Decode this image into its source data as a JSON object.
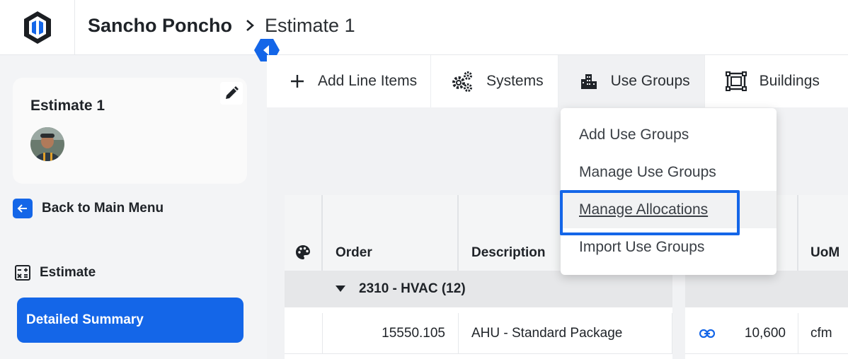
{
  "header": {
    "project": "Sancho Poncho",
    "current": "Estimate 1"
  },
  "sidebar": {
    "estimate_title": "Estimate 1",
    "back_label": "Back to Main Menu",
    "section_label": "Estimate",
    "active_item": "Detailed Summary"
  },
  "toolbar": {
    "items": [
      {
        "label": "Add Line Items",
        "icon": "plus-icon"
      },
      {
        "label": "Systems",
        "icon": "gears-icon"
      },
      {
        "label": "Use Groups",
        "icon": "city-icon",
        "active": true
      },
      {
        "label": "Buildings",
        "icon": "building-frame-icon"
      }
    ]
  },
  "dropdown": {
    "items": [
      "Add Use Groups",
      "Manage Use Groups",
      "Manage Allocations",
      "Import Use Groups"
    ],
    "focused_index": 2
  },
  "table": {
    "headers": {
      "palette": "palette-icon",
      "order": "Order",
      "description": "Description",
      "uom": "UoM"
    },
    "group": "2310 - HVAC (12)",
    "rows": [
      {
        "order": "15550.105",
        "description": "AHU - Standard Package",
        "quantity": "10,600",
        "uom": "cfm"
      }
    ]
  },
  "colors": {
    "accent": "#1466e8",
    "sidebar_bg": "#f3f4f6",
    "main_bg": "#f1f2f4"
  }
}
